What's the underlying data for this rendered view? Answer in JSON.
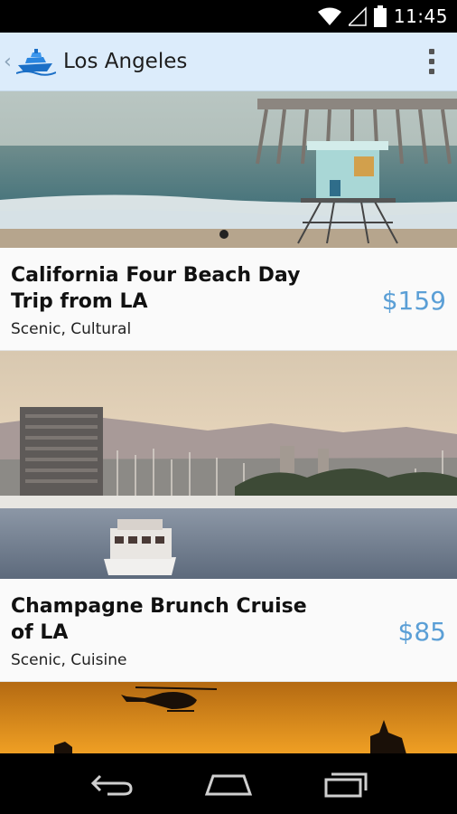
{
  "status_bar": {
    "time": "11:45"
  },
  "action_bar": {
    "title": "Los Angeles"
  },
  "tours": [
    {
      "title": "California Four Beach Day Trip from LA",
      "tags": "Scenic, Cultural",
      "price": "$159"
    },
    {
      "title": "Champagne Brunch Cruise of LA",
      "tags": "Scenic, Cuisine",
      "price": "$85"
    }
  ],
  "colors": {
    "action_bar_bg": "#dcecfb",
    "price": "#5b9fd6"
  },
  "icons": [
    "wifi-icon",
    "signal-icon",
    "battery-icon",
    "cruise-ship-app-icon",
    "overflow-menu-icon",
    "back-nav-icon",
    "home-nav-icon",
    "recents-nav-icon"
  ]
}
